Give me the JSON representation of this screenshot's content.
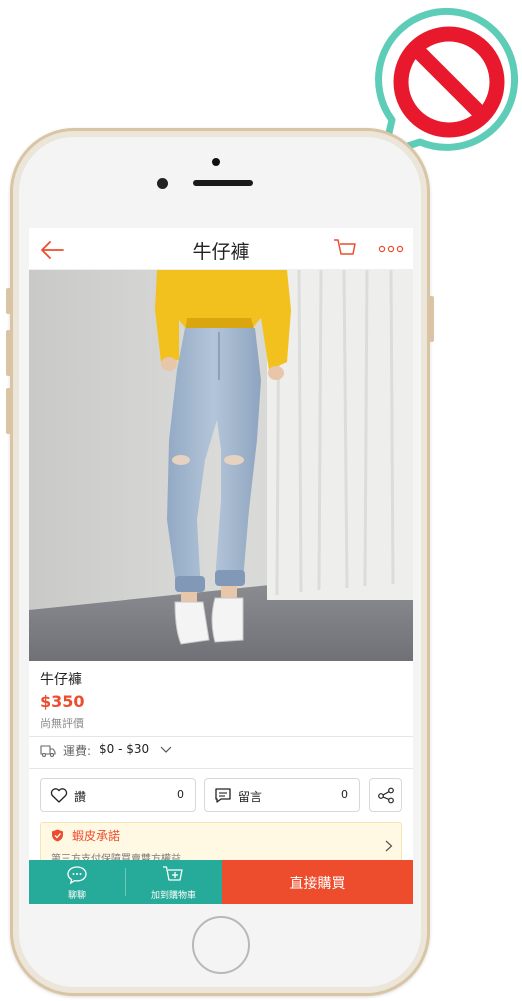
{
  "overlay": {
    "icon": "prohibition-icon",
    "color": "#e8192c",
    "ring": "#5ecdb8"
  },
  "phone": {
    "frame": "gold-iphone"
  },
  "app": {
    "accent": "#ee4d2d",
    "teal": "#26aa99",
    "header": {
      "title": "牛仔褲",
      "back_icon": "arrow-left-icon",
      "cart_icon": "cart-icon",
      "more_icon": "more-dots-icon"
    }
  },
  "product": {
    "name": "牛仔褲",
    "price": "$350",
    "rating_text": "尚無評價",
    "shipping_label": "運費:",
    "shipping_value": "$0 - $30"
  },
  "actions": {
    "like_label": "讚",
    "like_count": "0",
    "comment_label": "留言",
    "comment_count": "0"
  },
  "guarantee": {
    "title": "蝦皮承諾",
    "subtitle": "第三方支付保障買賣雙方權益"
  },
  "bottom_bar": {
    "chat_label": "聊聊",
    "add_to_cart_label": "加到購物車",
    "buy_now_label": "直接購買"
  }
}
